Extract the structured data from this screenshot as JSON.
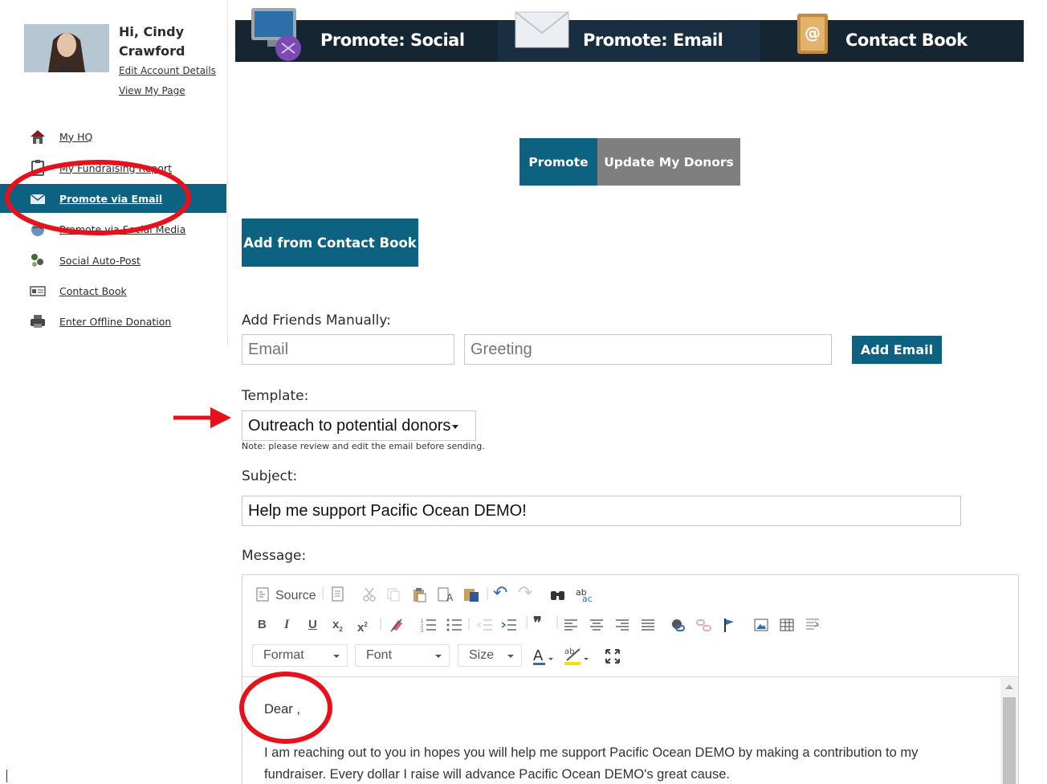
{
  "user": {
    "greeting_line1": "Hi, Cindy",
    "greeting_line2": "Crawford",
    "edit_account": "Edit Account Details",
    "view_page": "View My Page"
  },
  "sidebar": {
    "items": [
      {
        "label": "My HQ",
        "icon": "house-icon"
      },
      {
        "label": "My Fundraising Report",
        "icon": "report-icon"
      },
      {
        "label": "Promote via Email",
        "icon": "envelope-icon",
        "active": true
      },
      {
        "label": "Promote via Social Media",
        "icon": "globe-icon"
      },
      {
        "label": "Social Auto-Post",
        "icon": "people-icon"
      },
      {
        "label": "Contact Book",
        "icon": "contact-card-icon"
      },
      {
        "label": "Enter Offline Donation",
        "icon": "printer-icon"
      }
    ]
  },
  "topnav": {
    "tabs": [
      {
        "label": "Promote: Social",
        "icon": "monitor-icon"
      },
      {
        "label": "Promote: Email",
        "icon": "envelope-icon"
      },
      {
        "label": "Contact Book",
        "icon": "address-book-icon"
      }
    ]
  },
  "toggle": {
    "promote": "Promote",
    "update": "Update My Donors"
  },
  "add_contact_book": "Add from Contact Book",
  "add_friends": {
    "label": "Add Friends Manually:",
    "email_placeholder": "Email",
    "greeting_placeholder": "Greeting",
    "button": "Add Email"
  },
  "template": {
    "label": "Template:",
    "selected": "Outreach to potential donors",
    "note": "Note: please review and edit the email before sending."
  },
  "subject": {
    "label": "Subject:",
    "value": "Help me support Pacific Ocean DEMO!"
  },
  "message": {
    "label": "Message:",
    "toolbar": {
      "source": "Source",
      "bold": "B",
      "italic": "I",
      "underline": "U",
      "subscript": "x",
      "superscript": "x",
      "format": "Format",
      "font": "Font",
      "size": "Size"
    },
    "salutation": "Dear ,",
    "body_line1": "I am reaching out to you in hopes you will help me support Pacific Ocean DEMO by making a contribution to my",
    "body_line2": "fundraiser. Every dollar I raise will advance Pacific Ocean DEMO's great cause."
  },
  "colors": {
    "brand_blue": "#0d6282",
    "nav_dark": "#162532",
    "annotation_red": "#e8101b",
    "inactive_gray": "#7f7f7f"
  }
}
